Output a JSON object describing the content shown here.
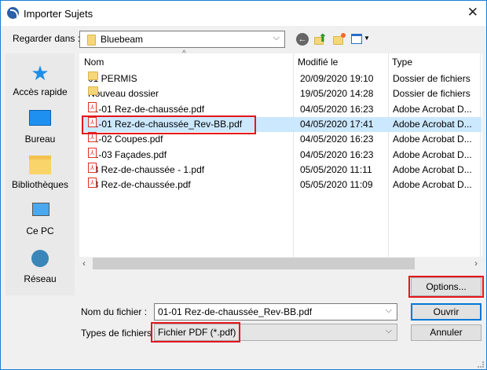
{
  "window": {
    "title": "Importer Sujets"
  },
  "lookin": {
    "label": "Regarder dans :",
    "value": "Bluebeam"
  },
  "toolbar": {
    "icons": [
      "back-icon",
      "up-folder-icon",
      "new-folder-icon",
      "view-menu-icon"
    ]
  },
  "sidebar": {
    "items": [
      {
        "label": "Accès rapide",
        "icon": "star-icon"
      },
      {
        "label": "Bureau",
        "icon": "desktop-icon"
      },
      {
        "label": "Bibliothèques",
        "icon": "libraries-icon"
      },
      {
        "label": "Ce PC",
        "icon": "computer-icon"
      },
      {
        "label": "Réseau",
        "icon": "network-icon"
      }
    ]
  },
  "list": {
    "headers": {
      "name": "Nom",
      "modified": "Modifié le",
      "type": "Type"
    },
    "rows": [
      {
        "name": "01 PERMIS",
        "modified": "20/09/2020 19:10",
        "type": "Dossier de fichiers",
        "kind": "folder"
      },
      {
        "name": "Nouveau dossier",
        "modified": "19/05/2020 14:28",
        "type": "Dossier de fichiers",
        "kind": "folder"
      },
      {
        "name": "01-01 Rez-de-chaussée.pdf",
        "modified": "04/05/2020 16:23",
        "type": "Adobe Acrobat D...",
        "kind": "pdf"
      },
      {
        "name": "01-01 Rez-de-chaussée_Rev-BB.pdf",
        "modified": "04/05/2020 17:41",
        "type": "Adobe Acrobat D...",
        "kind": "pdf",
        "selected": true
      },
      {
        "name": "01-02 Coupes.pdf",
        "modified": "04/05/2020 16:23",
        "type": "Adobe Acrobat D...",
        "kind": "pdf"
      },
      {
        "name": "01-03 Façades.pdf",
        "modified": "04/05/2020 16:23",
        "type": "Adobe Acrobat D...",
        "kind": "pdf"
      },
      {
        "name": "03 Rez-de-chaussée - 1.pdf",
        "modified": "05/05/2020 11:11",
        "type": "Adobe Acrobat D...",
        "kind": "pdf"
      },
      {
        "name": "03 Rez-de-chaussée.pdf",
        "modified": "05/05/2020 11:09",
        "type": "Adobe Acrobat D...",
        "kind": "pdf"
      }
    ]
  },
  "buttons": {
    "options": "Options...",
    "open": "Ouvrir",
    "cancel": "Annuler"
  },
  "filename": {
    "label": "Nom du fichier :",
    "value": "01-01 Rez-de-chaussée_Rev-BB.pdf"
  },
  "filetype": {
    "label": "Types de fichiers :",
    "value": "Fichier PDF (*.pdf)"
  },
  "colors": {
    "accent": "#1a7fd6",
    "highlight": "#e3161c",
    "selection": "#cce8ff"
  }
}
